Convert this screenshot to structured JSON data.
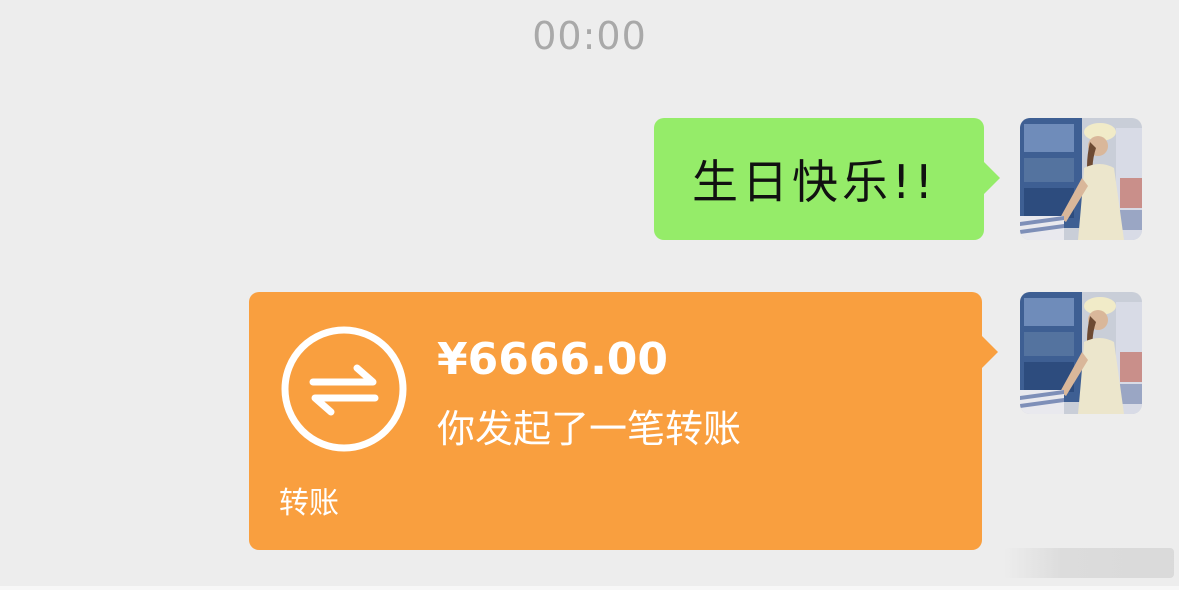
{
  "chat": {
    "timestamp": "00:00",
    "messages": [
      {
        "type": "text",
        "sender": "self",
        "text": "生日快乐!!"
      },
      {
        "type": "transfer",
        "sender": "self",
        "amount": "¥6666.00",
        "description": "你发起了一笔转账",
        "footer": "转账",
        "icon": "transfer-arrows-icon"
      }
    ]
  },
  "colors": {
    "background": "#ededed",
    "text_bubble": "#95ec69",
    "transfer_card": "#f99f3f",
    "timestamp": "#a9a9a9"
  }
}
